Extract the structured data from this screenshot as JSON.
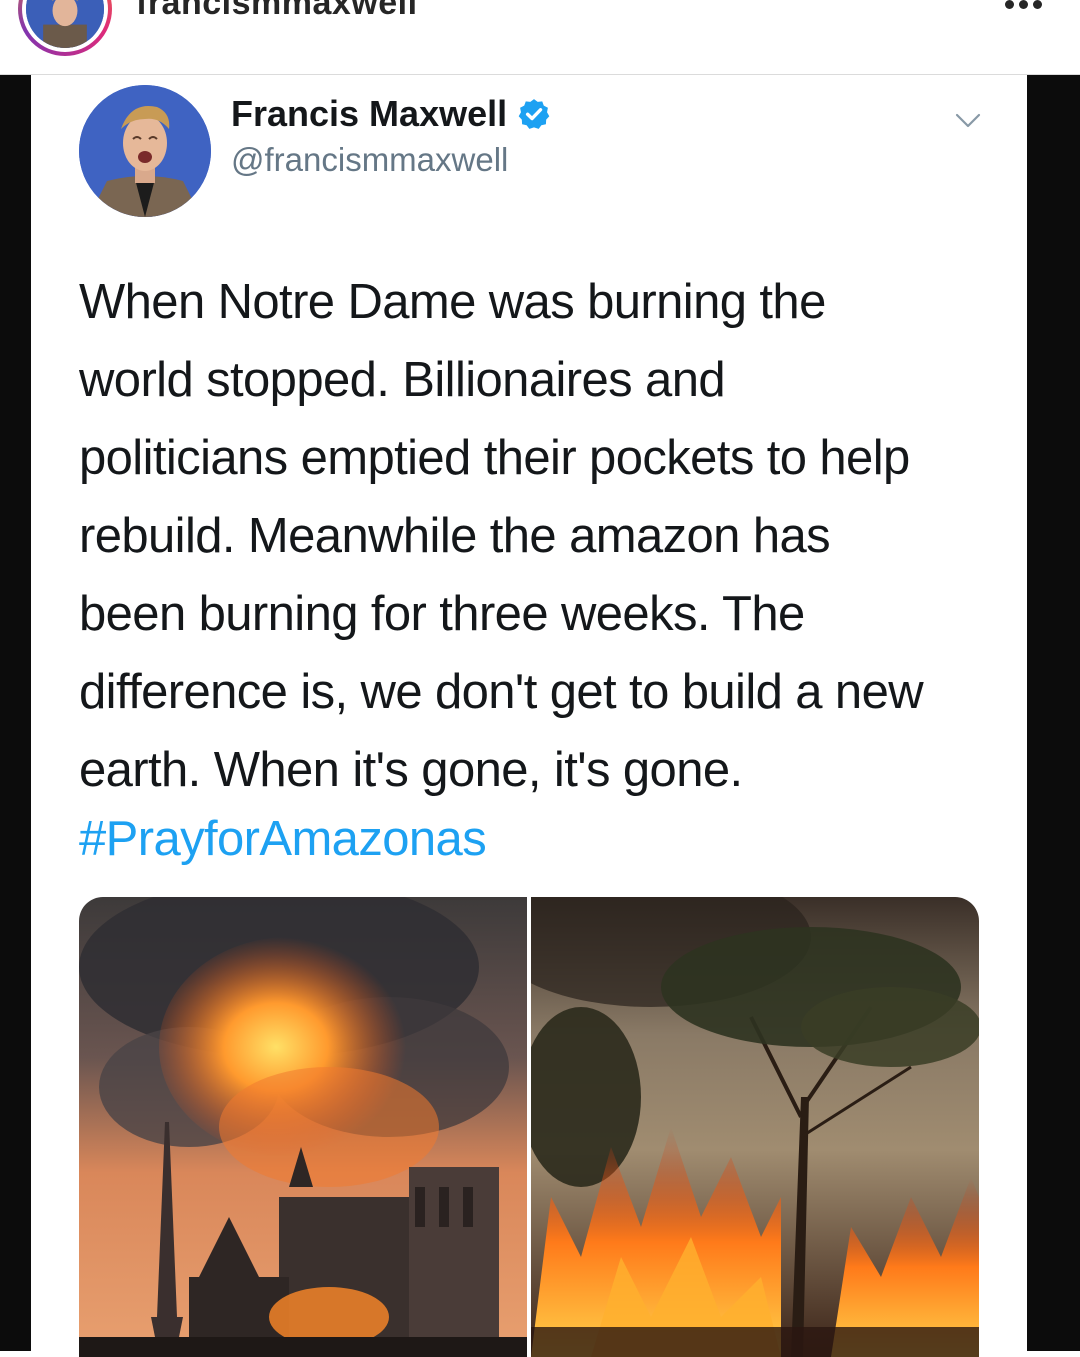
{
  "ig": {
    "username": "francismmaxwell"
  },
  "tweet": {
    "display_name": "Francis Maxwell",
    "handle": "@francismmaxwell",
    "text_lines": [
      "When Notre Dame was burning the",
      "world stopped. Billionaires and",
      "politicians emptied their pockets to help",
      "rebuild. Meanwhile the amazon has",
      "been burning for three weeks. The",
      "difference is, we don't get to build a new",
      "earth. When it's gone, it's gone."
    ],
    "hashtag": "#PrayforAmazonas"
  },
  "colors": {
    "hashtag": "#1da1f2",
    "verified": "#1da1f2",
    "handle": "#657786"
  },
  "icons": {
    "more": "more-options-icon",
    "verified": "verified-badge-icon",
    "chevron": "chevron-down-icon"
  }
}
